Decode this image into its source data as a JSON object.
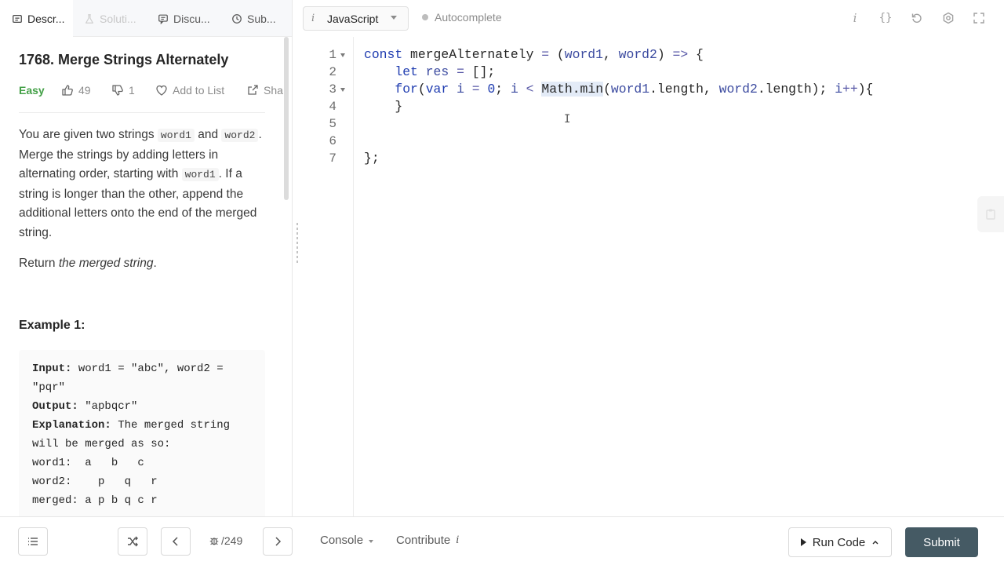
{
  "tabs": [
    {
      "label": "Descr...",
      "icon": "description-icon",
      "state": "active"
    },
    {
      "label": "Soluti...",
      "icon": "flask-icon",
      "state": "disabled"
    },
    {
      "label": "Discu...",
      "icon": "discuss-icon",
      "state": "normal"
    },
    {
      "label": "Sub...",
      "icon": "clock-icon",
      "state": "normal"
    }
  ],
  "problem": {
    "title": "1768. Merge Strings Alternately",
    "difficulty": "Easy",
    "likes": "49",
    "dislikes": "1",
    "add_to_list": "Add to List",
    "share": "Sha"
  },
  "description": {
    "p1_a": "You are given two strings ",
    "p1_code1": "word1",
    "p1_b": " and ",
    "p1_code2": "word2",
    "p1_c": ". Merge the strings by adding letters in alternating order, starting with ",
    "p1_code3": "word1",
    "p1_d": ". If a string is longer than the other, append the additional letters onto the end of the merged string.",
    "p2_a": "Return ",
    "p2_em": "the merged string",
    "p2_b": "."
  },
  "example": {
    "title": "Example 1:",
    "input_label": "Input:",
    "input_value": " word1 = \"abc\", word2 =\n\"pqr\"",
    "output_label": "Output:",
    "output_value": " \"apbqcr\"",
    "explanation_label": "Explanation:",
    "explanation_value": " The merged string\nwill be merged as so:\nword1:  a   b   c\nword2:    p   q   r\nmerged: a p b q c r"
  },
  "toolbar": {
    "language": "JavaScript",
    "autocomplete": "Autocomplete",
    "icons": [
      "info-icon",
      "braces-icon",
      "reset-icon",
      "settings-icon",
      "fullscreen-icon"
    ]
  },
  "editor": {
    "line_numbers": [
      "1",
      "2",
      "3",
      "4",
      "5",
      "6",
      "7"
    ],
    "lines": [
      "const mergeAlternately = (word1, word2) => {",
      "    let res = [];",
      "    for(var i = 0; i < Math.min(word1.length, word2.length); i++){",
      "    }",
      "",
      "",
      "};"
    ]
  },
  "bottom": {
    "pager": "/249",
    "console": "Console",
    "contribute": "Contribute",
    "run_code": "Run Code",
    "submit": "Submit"
  },
  "colors": {
    "easy": "#43a047",
    "submit_bg": "#455a64",
    "keyword": "#1f3cb0"
  }
}
